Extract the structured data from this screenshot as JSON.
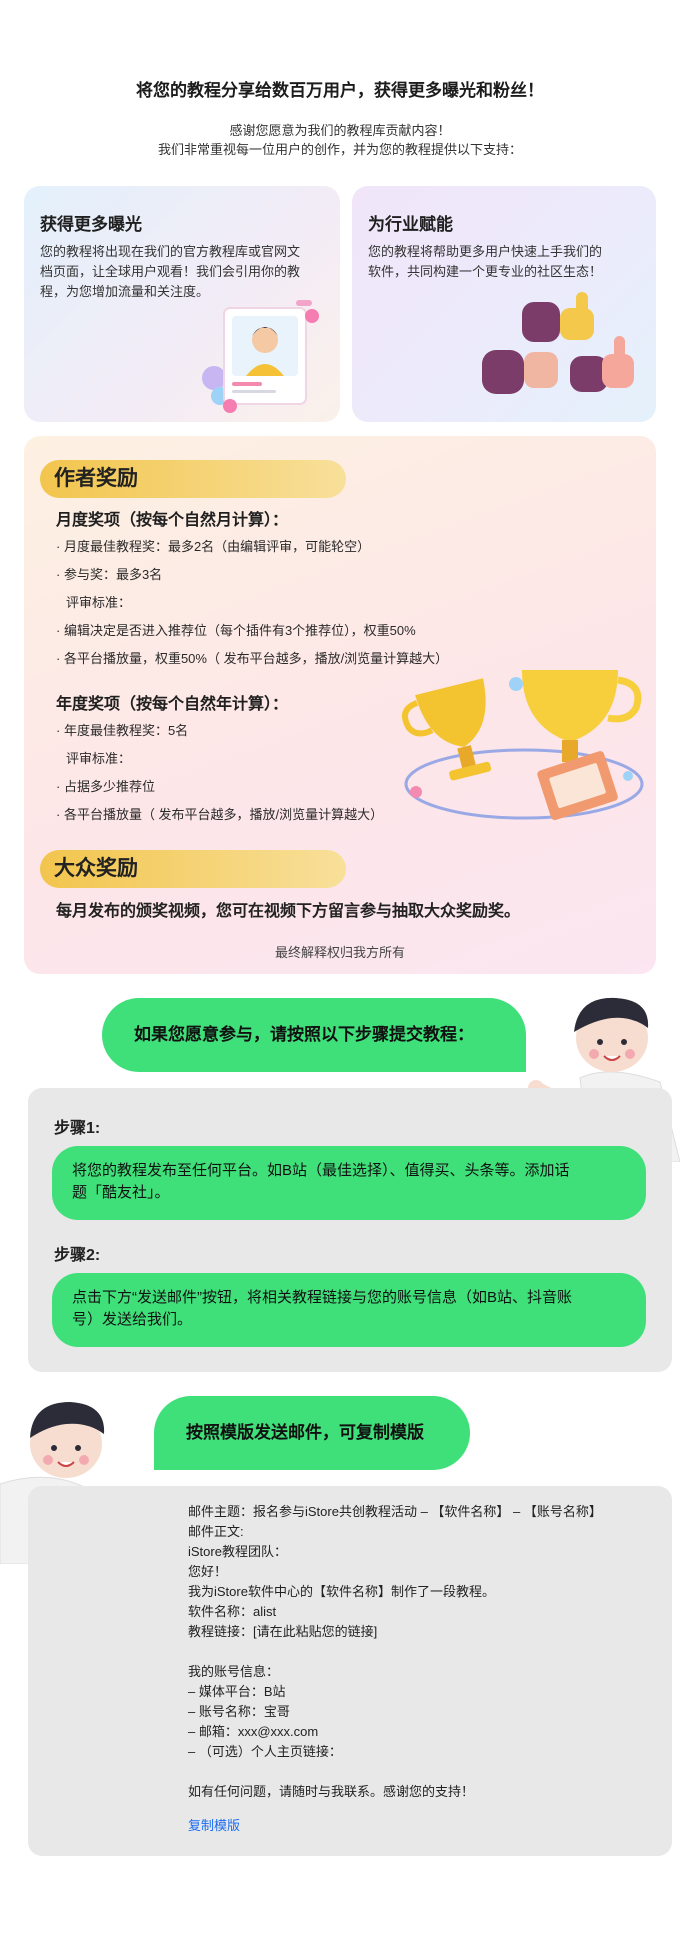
{
  "header": {
    "title": "将您的教程分享给数百万用户，获得更多曝光和粉丝！",
    "intro_line1": "感谢您愿意为我们的教程库贡献内容！",
    "intro_line2": "我们非常重视每一位用户的创作，并为您的教程提供以下支持："
  },
  "benefits": [
    {
      "title": "获得更多曝光",
      "lines": [
        "您的教程将出现在我们的官方教程库或官网文",
        "档页面，让全球用户观看！我们会引用你的教",
        "程，为您增加流量和关注度。"
      ]
    },
    {
      "title": "为行业赋能",
      "lines": [
        "您的教程将帮助更多用户快速上手我们的",
        "软件，共同构建一个更专业的社区生态！"
      ]
    }
  ],
  "awards": {
    "author_title": "作者奖励",
    "monthly_title": "月度奖项（按每个自然月计算）：",
    "monthly_items": [
      "· 月度最佳教程奖：最多2名（由编辑评审，可能轮空）",
      "· 参与奖：最多3名",
      "评审标准：",
      "· 编辑决定是否进入推荐位（每个插件有3个推荐位），权重50%",
      "· 各平台播放量，权重50%（ 发布平台越多，播放/浏览量计算越大）"
    ],
    "yearly_title": "年度奖项（按每个自然年计算）：",
    "yearly_items": [
      "· 年度最佳教程奖：5名",
      "评审标准：",
      "· 占据多少推荐位",
      "· 各平台播放量（ 发布平台越多，播放/浏览量计算越大）"
    ],
    "public_title": "大众奖励",
    "public_text": "每月发布的颁奖视频，您可在视频下方留言参与抽取大众奖励奖。",
    "disclaimer": "最终解释权归我方所有"
  },
  "steps": {
    "banner": "如果您愿意参与，请按照以下步骤提交教程：",
    "step1_label": "步骤1:",
    "step1_lines": [
      "将您的教程发布至任何平台。如B站（最佳选择）、值得买、头条等。添加话",
      "题「酷友社」。"
    ],
    "step2_label": "步骤2:",
    "step2_lines": [
      "点击下方“发送邮件”按钮，将相关教程链接与您的账号信息（如B站、抖音账",
      "号）发送给我们。"
    ]
  },
  "template": {
    "banner": "按照模版发送邮件，可复制模版",
    "lines": [
      "邮件主题：报名参与iStore共创教程活动 – 【软件名称】 – 【账号名称】",
      "邮件正文:",
      "iStore教程团队：",
      "您好！",
      "我为iStore软件中心的【软件名称】制作了一段教程。",
      "软件名称：alist",
      "教程链接：[请在此粘贴您的链接]",
      "",
      "我的账号信息：",
      "– 媒体平台：B站",
      "– 账号名称：宝哥",
      "– 邮箱：xxx@xxx.com",
      "– （可选）个人主页链接：",
      "",
      "如有任何问题，请随时与我联系。感谢您的支持！"
    ],
    "copy_label": "复制模版"
  },
  "colors": {
    "green": "#3fe07a",
    "gold": "#f2c54d",
    "link": "#1b6cf2"
  }
}
